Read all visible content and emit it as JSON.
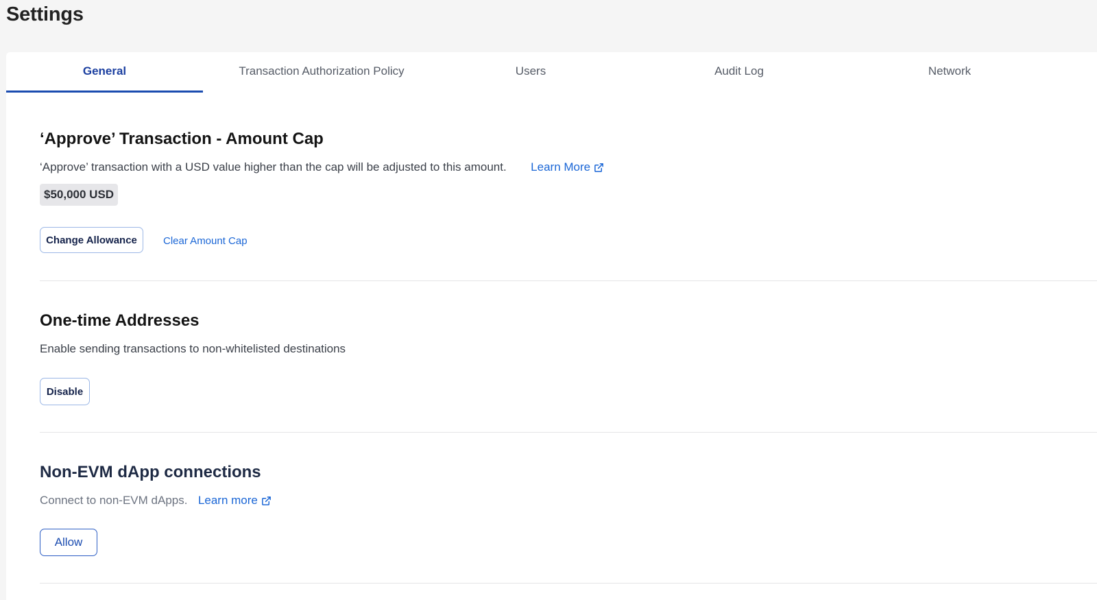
{
  "page": {
    "title": "Settings"
  },
  "tabs": [
    {
      "label": "General",
      "active": true
    },
    {
      "label": "Transaction Authorization Policy",
      "active": false
    },
    {
      "label": "Users",
      "active": false
    },
    {
      "label": "Audit Log",
      "active": false
    },
    {
      "label": "Network",
      "active": false
    }
  ],
  "amount_cap": {
    "title": "‘Approve’ Transaction - Amount Cap",
    "description": "‘Approve’ transaction with a USD value higher than the cap will be adjusted to this amount.",
    "learn_more_label": "Learn More",
    "learn_more_icon": "external-link-icon",
    "value": "$50,000 USD",
    "change_button": "Change Allowance",
    "clear_link": "Clear Amount Cap"
  },
  "one_time_addresses": {
    "title": "One-time Addresses",
    "description": "Enable sending transactions to non-whitelisted destinations",
    "button": "Disable"
  },
  "non_evm": {
    "title": "Non-EVM dApp connections",
    "description": "Connect to non-EVM dApps.",
    "learn_more_label": "Learn more",
    "learn_more_icon": "external-link-icon",
    "button": "Allow"
  },
  "colors": {
    "accent": "#1b4cb0",
    "link": "#1a66d6",
    "background": "#f5f5f5",
    "panel": "#ffffff"
  }
}
